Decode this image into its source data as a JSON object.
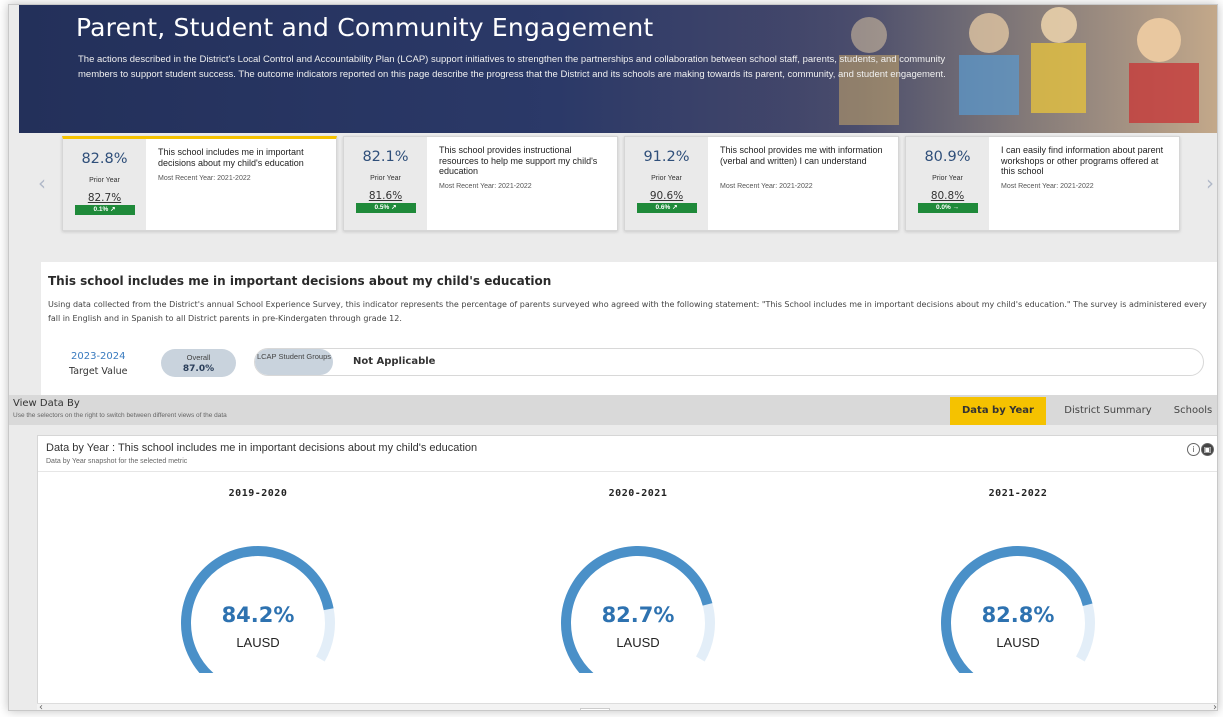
{
  "hero": {
    "title": "Parent, Student and Community Engagement",
    "description": "The actions described in the District's Local Control and Accountability Plan (LCAP) support initiatives to strengthen the partnerships and collaboration between school staff, parents, students, and community members to support student success. The outcome indicators reported on this page describe the progress that the District and its schools are making towards its parent, community, and student engagement."
  },
  "carousel": {
    "prev_icon": "chevron-left-icon",
    "next_icon": "chevron-right-icon",
    "cards": [
      {
        "pct": "82.8%",
        "prior_label": "Prior Year",
        "prior_val": "82.7%",
        "delta": "0.1% ↗",
        "desc": "This school includes me in important decisions about my child's education",
        "recent": "Most Recent Year: 2021-2022"
      },
      {
        "pct": "82.1%",
        "prior_label": "Prior Year",
        "prior_val": "81.6%",
        "delta": "0.5% ↗",
        "desc": "This school provides instructional resources to help me support my child's education",
        "recent": "Most Recent Year: 2021-2022"
      },
      {
        "pct": "91.2%",
        "prior_label": "Prior Year",
        "prior_val": "90.6%",
        "delta": "0.6% ↗",
        "desc": "This school provides me with information (verbal and written) I can understand",
        "recent": "Most Recent Year: 2021-2022"
      },
      {
        "pct": "80.9%",
        "prior_label": "Prior Year",
        "prior_val": "80.8%",
        "delta": "0.0% →",
        "desc": "I can easily find information about parent workshops or other programs offered at this school",
        "recent": "Most Recent Year: 2021-2022"
      }
    ]
  },
  "detail": {
    "title": "This school includes me in important decisions about my child's education",
    "text": "Using data collected from the District's annual School Experience Survey, this indicator represents the percentage of parents surveyed who agreed with the following statement: \"This School includes me in important decisions about my child's education.\" The survey is administered every fall in English and in Spanish to all District parents in pre-Kindergaten through grade 12."
  },
  "target": {
    "year": "2023-2024",
    "label": "Target Value",
    "overall_label": "Overall",
    "overall_value": "87.0%",
    "groups_label": "LCAP Student Groups",
    "groups_value": "Not Applicable"
  },
  "viewbar": {
    "title": "View Data By",
    "subtitle": "Use the selectors on the right to switch between different views of the data",
    "tabs": [
      "Data by Year",
      "District Summary",
      "Schools"
    ]
  },
  "panel": {
    "title": "Data by Year : This school includes me in important decisions about my child's education",
    "subtitle": "Data by Year snapshot for the selected metric",
    "info_icon": "info-icon",
    "print_icon": "print-icon"
  },
  "gauges": [
    {
      "year": "2019-2020",
      "value": "84.2%",
      "fraction": 0.842,
      "label": "LAUSD"
    },
    {
      "year": "2020-2021",
      "value": "82.7%",
      "fraction": 0.827,
      "label": "LAUSD"
    },
    {
      "year": "2021-2022",
      "value": "82.8%",
      "fraction": 0.828,
      "label": "LAUSD"
    }
  ],
  "colors": {
    "accent_yellow": "#f5c200",
    "delta_green": "#1f8a3a",
    "gauge_fill": "#4a90c8",
    "gauge_track": "#e3eef8",
    "hero_navy": "#23305a"
  }
}
